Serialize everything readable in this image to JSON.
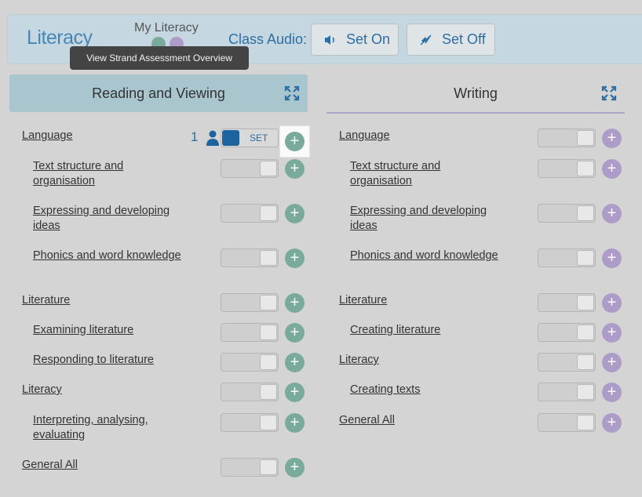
{
  "header": {
    "title": "Literacy",
    "my_literacy": "My Literacy",
    "tooltip": "View Strand Assessment Overview",
    "audio_label": "Class Audio:",
    "set_on": "Set On",
    "set_off": "Set Off"
  },
  "colors": {
    "green": "#7aaa9b",
    "purple": "#ad9cc8",
    "blue": "#2d6ea3"
  },
  "left": {
    "title": "Reading and Viewing",
    "count": "1",
    "set_label": "SET",
    "rows": [
      "Language",
      "Text structure and organisation",
      "Expressing and developing ideas",
      "Phonics and word knowledge",
      "Literature",
      "Examining literature",
      "Responding to literature",
      "Literacy",
      "Interpreting, analysing, evaluating",
      "General All"
    ]
  },
  "right": {
    "title": "Writing",
    "rows": [
      "Language",
      "Text structure and organisation",
      "Expressing and developing ideas",
      "Phonics and word knowledge",
      "Literature",
      "Creating literature",
      "Literacy",
      "Creating texts",
      "General All"
    ]
  }
}
